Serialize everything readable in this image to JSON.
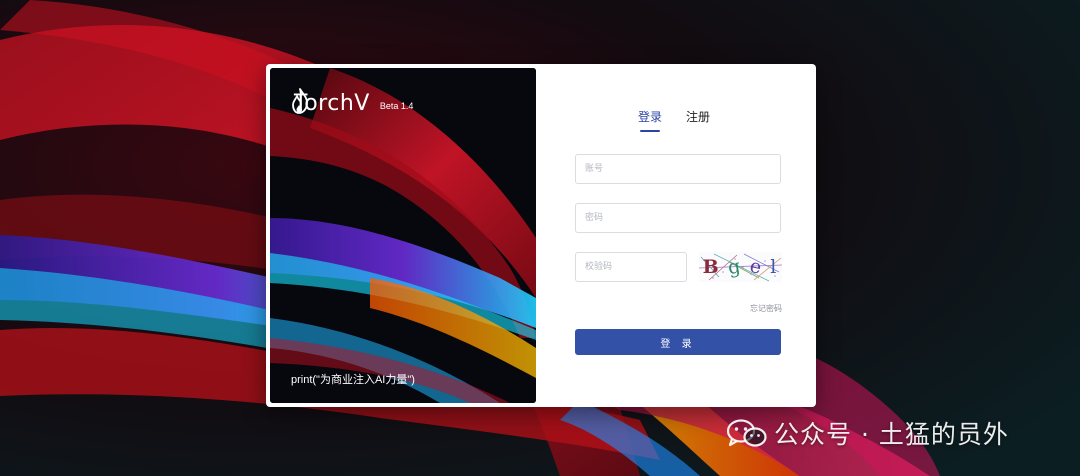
{
  "brand": {
    "name": "TorchV",
    "version": "Beta 1.4",
    "slogan": "print(\"为商业注入AI力量\")"
  },
  "tabs": [
    {
      "label": "登录",
      "active": true
    },
    {
      "label": "注册",
      "active": false
    }
  ],
  "form": {
    "account_placeholder": "账号",
    "password_placeholder": "密码",
    "captcha_placeholder": "校验码",
    "captcha_text": [
      "B",
      "g",
      "e",
      "l"
    ],
    "forgot_label": "忘记密码",
    "submit_label": "登 录"
  },
  "watermark": {
    "text": "公众号 · 土猛的员外",
    "icon": "wechat-icon"
  },
  "colors": {
    "accent": "#2a45a4",
    "button": "#3451a8"
  }
}
